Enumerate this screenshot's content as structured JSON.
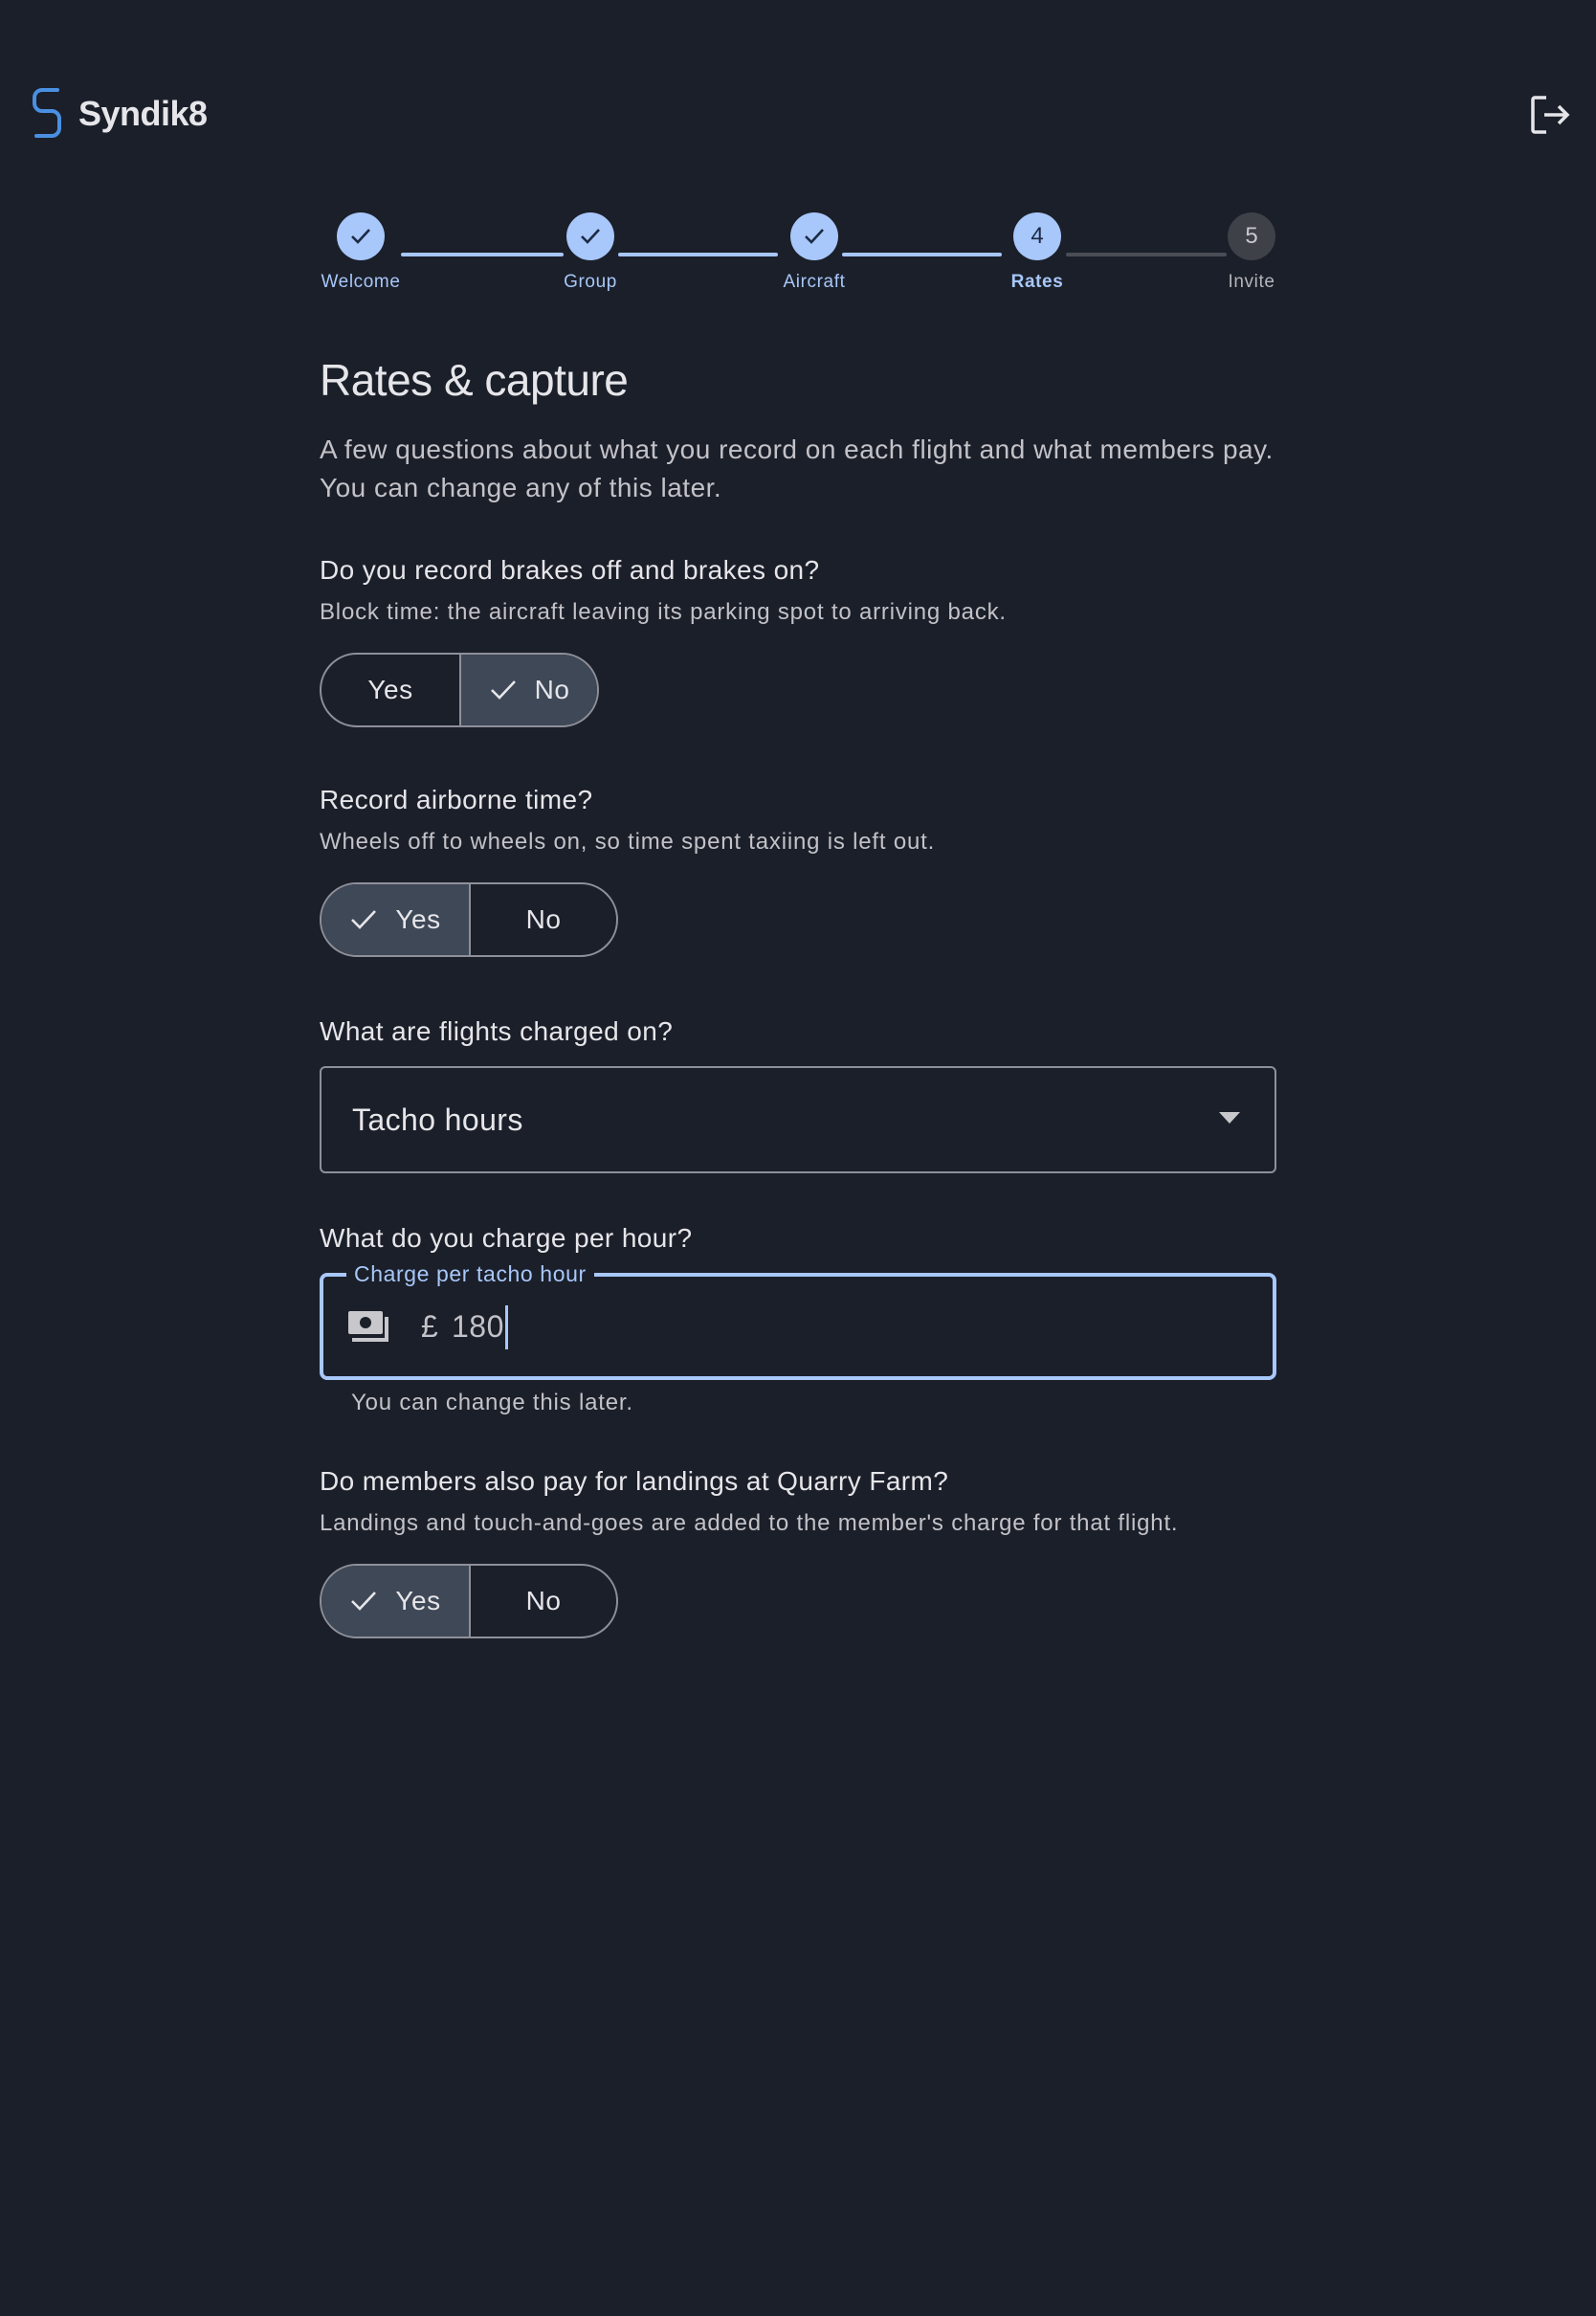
{
  "app": {
    "name": "Syndik8",
    "logout_icon": "logout-icon",
    "brand_color": "#4a90e2"
  },
  "stepper": {
    "steps": [
      {
        "label": "Welcome",
        "number": "1",
        "state": "done"
      },
      {
        "label": "Group",
        "number": "2",
        "state": "done"
      },
      {
        "label": "Aircraft",
        "number": "3",
        "state": "done"
      },
      {
        "label": "Rates",
        "number": "4",
        "state": "active"
      },
      {
        "label": "Invite",
        "number": "5",
        "state": "todo"
      }
    ]
  },
  "page": {
    "title": "Rates & capture",
    "subtitle": "A few questions about what you record on each flight and what members pay. You can change any of this later."
  },
  "questions": {
    "brakes": {
      "title": "Do you record brakes off and brakes on?",
      "help": "Block time: the aircraft leaving its parking spot to arriving back.",
      "options": [
        "Yes",
        "No"
      ],
      "selected": "No"
    },
    "airborne": {
      "title": "Record airborne time?",
      "help": "Wheels off to wheels on, so time spent taxiing is left out.",
      "options": [
        "Yes",
        "No"
      ],
      "selected": "Yes"
    },
    "charged_on": {
      "title": "What are flights charged on?",
      "value": "Tacho hours"
    },
    "charge": {
      "title": "What do you charge per hour?",
      "label": "Charge per tacho hour",
      "prefix": "£",
      "value": "180",
      "supporting": "You can change this later."
    },
    "landings": {
      "title": "Do members also pay for landings at Quarry Farm?",
      "help": "Landings and touch-and-goes are added to the member's charge for that flight.",
      "options": [
        "Yes",
        "No"
      ],
      "selected": "Yes"
    }
  }
}
